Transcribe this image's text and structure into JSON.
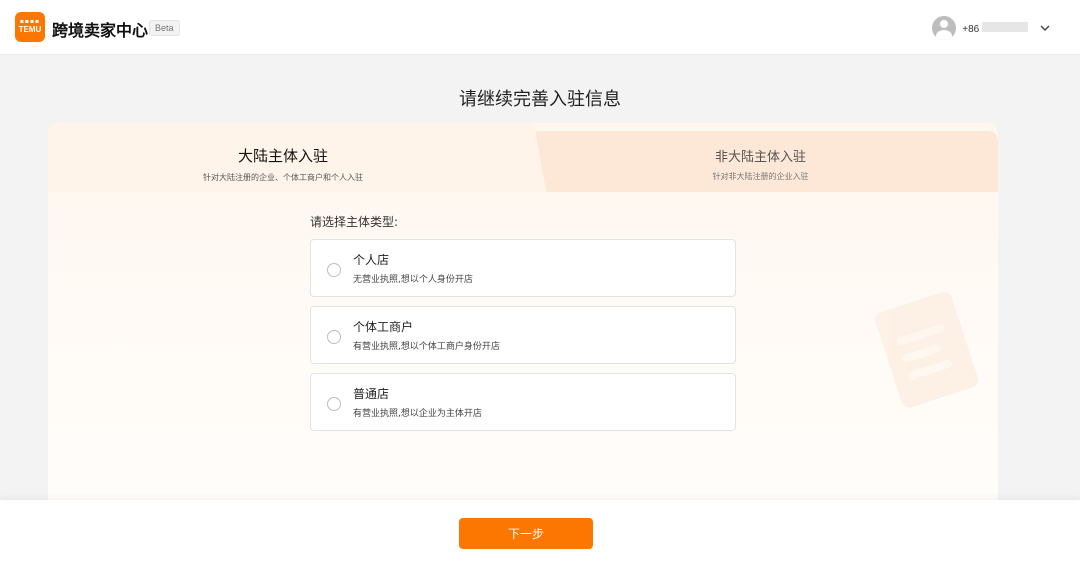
{
  "header": {
    "logo_text": "TEMU",
    "app_title": "跨境卖家中心",
    "beta_label": "Beta",
    "user": {
      "phone_prefix": "+86",
      "menu_icon": "chevron-down-icon"
    }
  },
  "page_title": "请继续完善入驻信息",
  "tabs": [
    {
      "title": "大陆主体入驻",
      "subtitle": "针对大陆注册的企业、个体工商户和个人入驻",
      "active": true
    },
    {
      "title": "非大陆主体入驻",
      "subtitle": "针对非大陆注册的企业入驻",
      "active": false
    }
  ],
  "form": {
    "section_label": "请选择主体类型:",
    "options": [
      {
        "title": "个人店",
        "description": "无营业执照,想以个人身份开店"
      },
      {
        "title": "个体工商户",
        "description": "有营业执照,想以个体工商户身份开店"
      },
      {
        "title": "普通店",
        "description": "有营业执照,想以企业为主体开店"
      }
    ]
  },
  "footer": {
    "next_label": "下一步"
  },
  "colors": {
    "accent": "#fb7701",
    "tab_active_bg": "#fff4ea",
    "tab_inactive_bg": "#fde7d6"
  }
}
